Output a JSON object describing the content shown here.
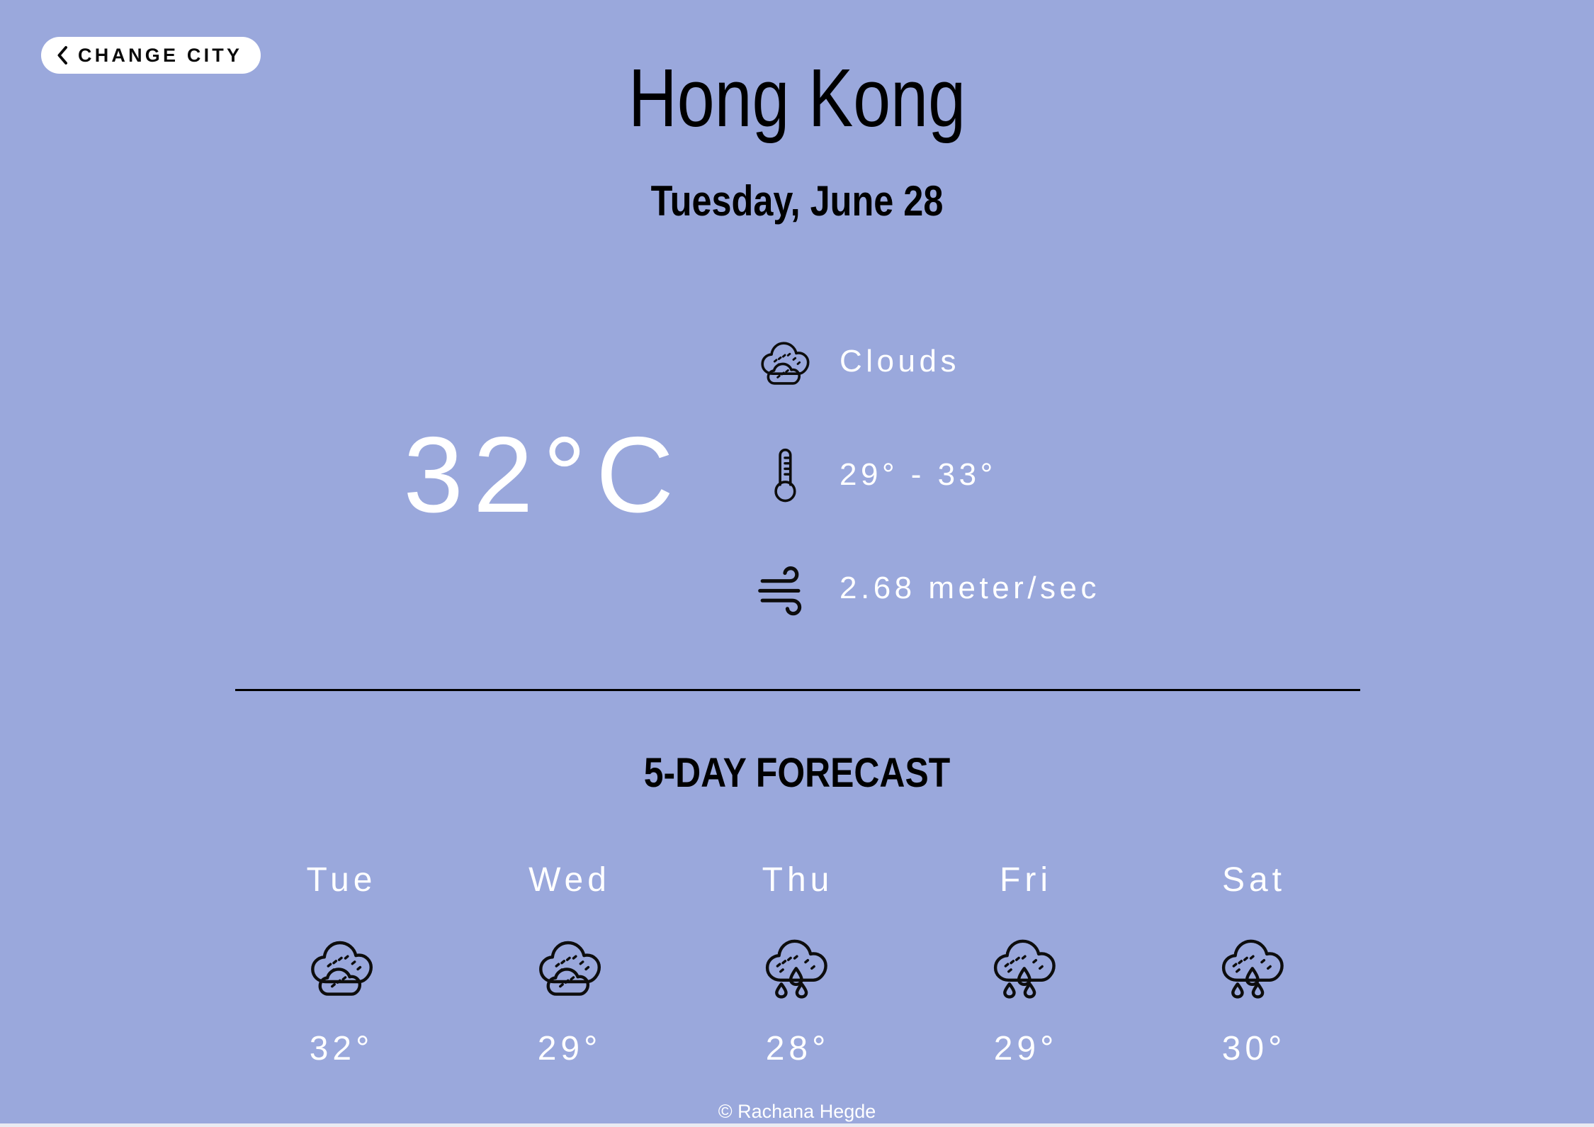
{
  "theme": {
    "background_color": "#9aa8dc",
    "text_on_background": "#ffffff",
    "accent_dark": "#000000",
    "button_background": "#ffffff"
  },
  "header": {
    "change_city_button_label": "CHANGE CITY",
    "change_city_icon": "chevron-left-icon",
    "city_name": "Hong Kong",
    "date": "Tuesday, June 28"
  },
  "current": {
    "temperature": "32°C",
    "conditions": {
      "icon": "clouds-icon",
      "label": "Clouds"
    },
    "range": {
      "icon": "thermometer-icon",
      "label": "29° - 33°"
    },
    "wind": {
      "icon": "wind-icon",
      "label": "2.68 meter/sec"
    }
  },
  "forecast": {
    "title": "5-DAY FORECAST",
    "days": [
      {
        "day": "Tue",
        "icon": "clouds-icon",
        "temp": "32°"
      },
      {
        "day": "Wed",
        "icon": "clouds-icon",
        "temp": "29°"
      },
      {
        "day": "Thu",
        "icon": "rain-icon",
        "temp": "28°"
      },
      {
        "day": "Fri",
        "icon": "rain-icon",
        "temp": "29°"
      },
      {
        "day": "Sat",
        "icon": "rain-icon",
        "temp": "30°"
      }
    ]
  },
  "footer": {
    "credit": "© Rachana Hegde"
  }
}
